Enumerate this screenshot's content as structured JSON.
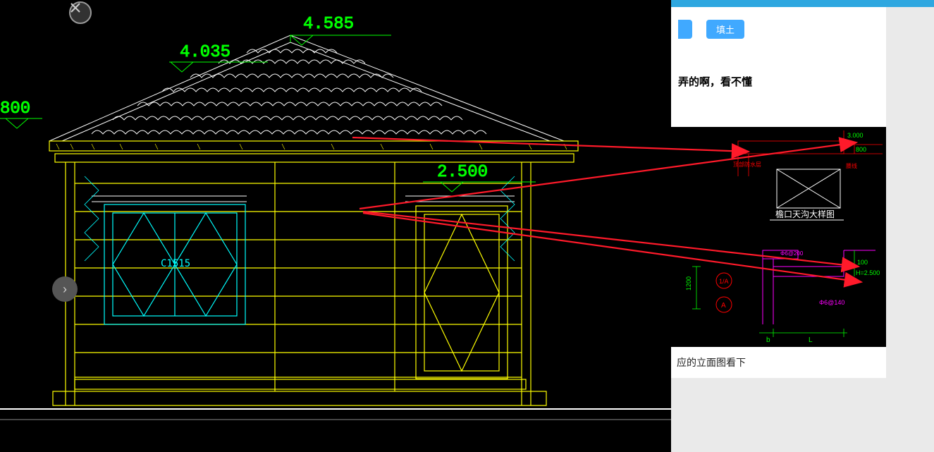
{
  "dimensions": {
    "ridge": "4.585",
    "eave": "4.035",
    "dim800": "800",
    "lintel": "2.500"
  },
  "window_tag": "C1515",
  "buttons": {
    "left_partial": "",
    "right": "填土"
  },
  "question": "弄的啊，看不懂",
  "caption": "应的立面图看下",
  "detail": {
    "title": "檐口天沟大样图",
    "label_b": "b",
    "label_L": "L",
    "dim1200": "1200",
    "dim100": "100",
    "h2500": "H=2.500",
    "dim800d": "800",
    "dim3000": "3.000",
    "axis_A": "A",
    "axis_1A": "1/A",
    "rebar1": "Φ6@140",
    "rebar2": "Φ6@200",
    "label_left": "顶部防水层",
    "label_br": "腰线"
  }
}
